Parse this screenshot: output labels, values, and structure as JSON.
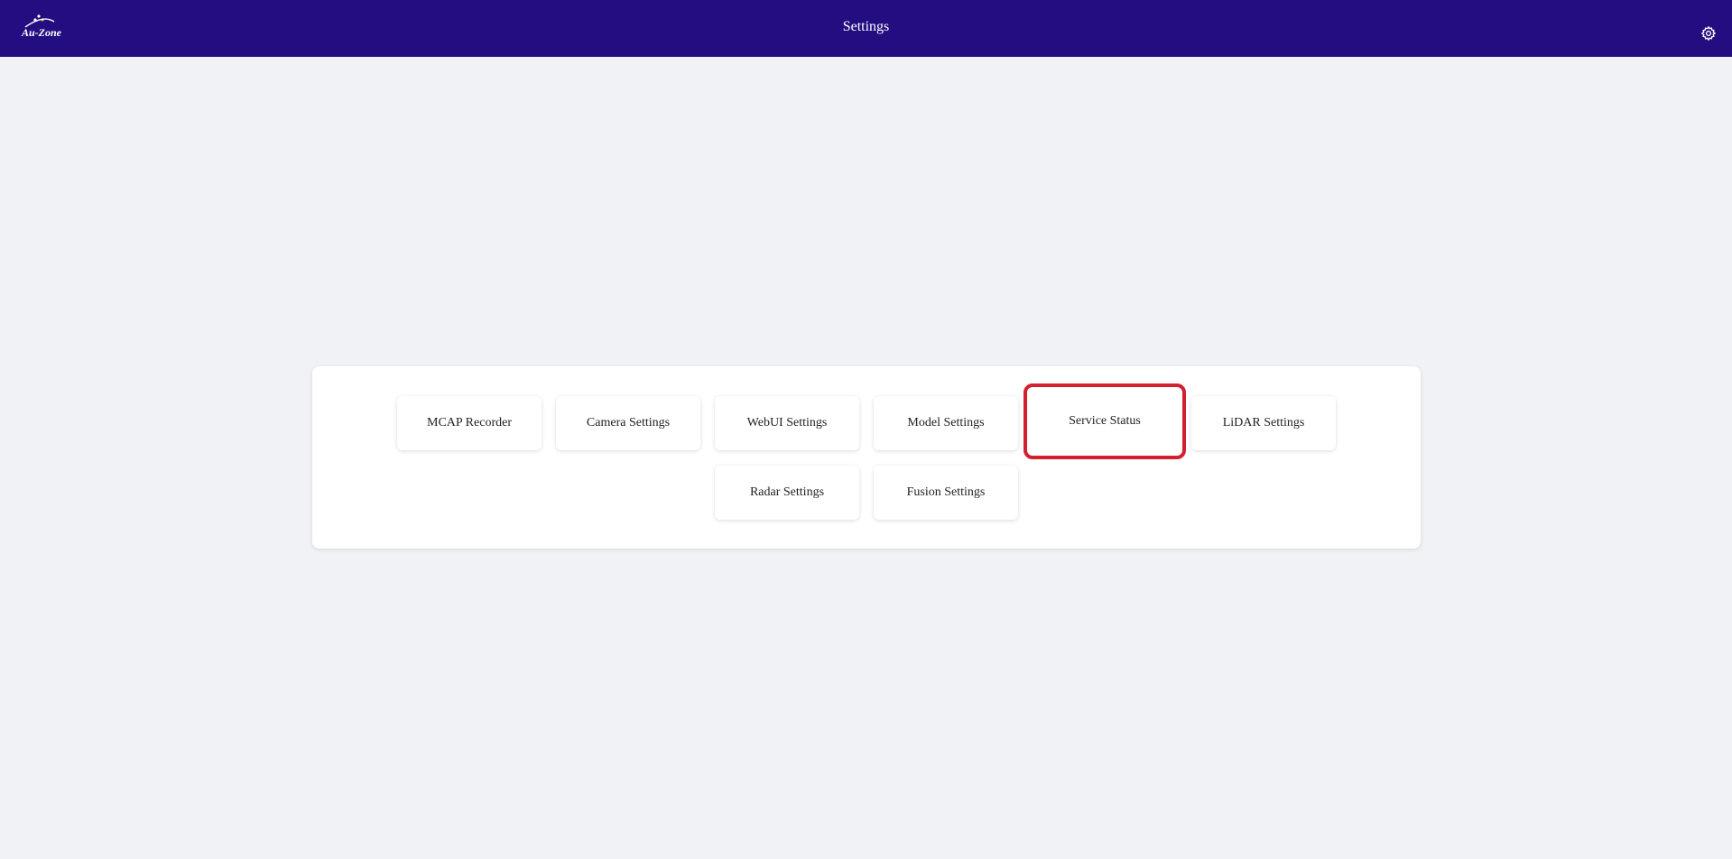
{
  "header": {
    "logo_text": "Au-Zone",
    "title": "Settings",
    "settings_icon": "gear-icon",
    "background_color": "#230d81"
  },
  "tiles": [
    {
      "label": "MCAP Recorder"
    },
    {
      "label": "Camera Settings"
    },
    {
      "label": "WebUI Settings"
    },
    {
      "label": "Model Settings"
    },
    {
      "label": "Service Status",
      "highlighted": true
    },
    {
      "label": "LiDAR Settings"
    },
    {
      "label": "Radar Settings"
    },
    {
      "label": "Fusion Settings"
    }
  ],
  "colors": {
    "page_background": "#f0f2f6",
    "highlight_border": "#d3202f"
  }
}
